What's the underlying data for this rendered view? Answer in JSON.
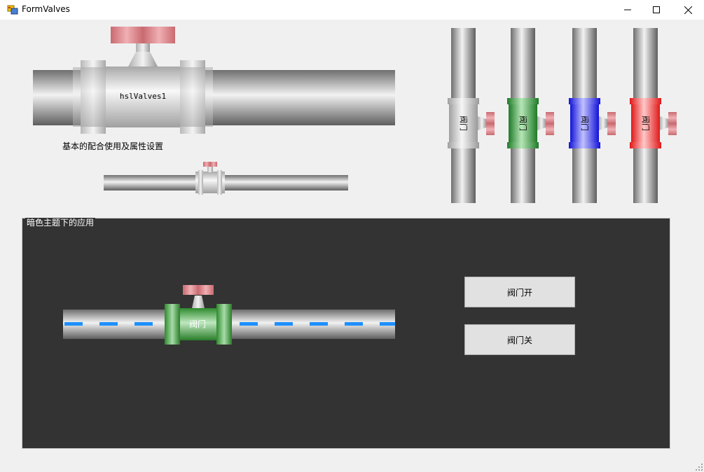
{
  "window": {
    "title": "FormValves",
    "minimize_label": "minimize",
    "maximize_label": "maximize",
    "close_label": "close"
  },
  "valves": {
    "large": {
      "text": "hslValves1"
    },
    "caption": "基本的配合使用及属性设置",
    "vertical": [
      {
        "text": "阀门",
        "color": "#c8c8c8"
      },
      {
        "text": "阀门",
        "color": "#2e9e3a"
      },
      {
        "text": "阀门",
        "color": "#1a1aff"
      },
      {
        "text": "阀门",
        "color": "#ff1a1a"
      }
    ]
  },
  "dark_group": {
    "title": "暗色主题下的应用",
    "valve_text": "阀门",
    "valve_color": "#3fa33f",
    "flow_color": "#1e90ff",
    "open_button": "阀门开",
    "close_button": "阀门关"
  }
}
